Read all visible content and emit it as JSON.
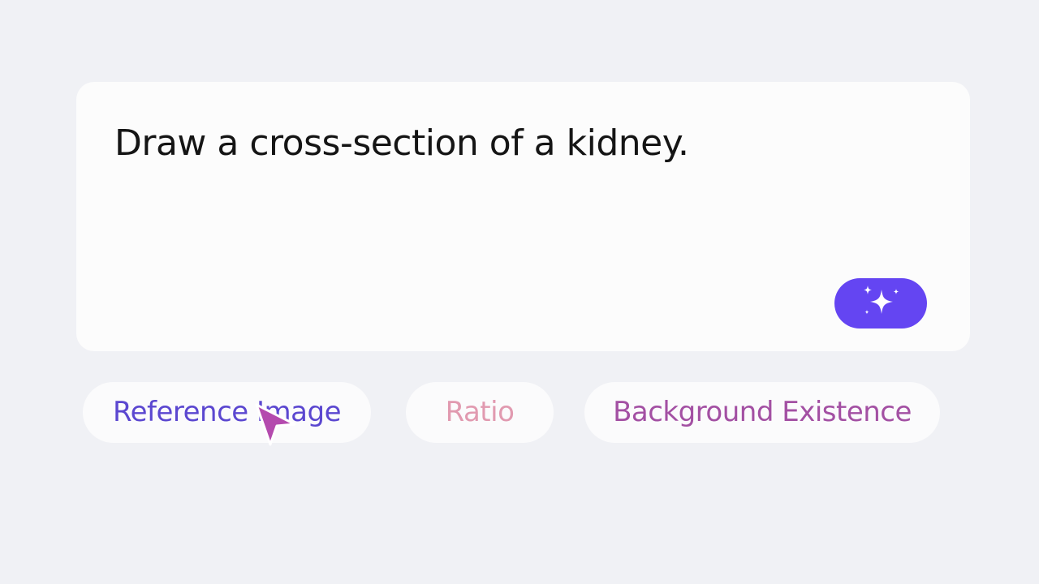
{
  "prompt": {
    "text": "Draw a cross-section of a kidney."
  },
  "generate_button": {
    "icon": "sparkle-icon",
    "color": "#6445f2"
  },
  "options": {
    "reference_image": "Reference Image",
    "ratio": "Ratio",
    "background_existence": "Background Existence"
  },
  "colors": {
    "background": "#f0f1f5",
    "card": "#fcfcfc",
    "reference_text": "#5b47d0",
    "ratio_text": "#e19ab0",
    "background_text": "#a350a3",
    "cursor": "#b44aae"
  },
  "cursor": {
    "icon": "mouse-pointer-icon"
  }
}
